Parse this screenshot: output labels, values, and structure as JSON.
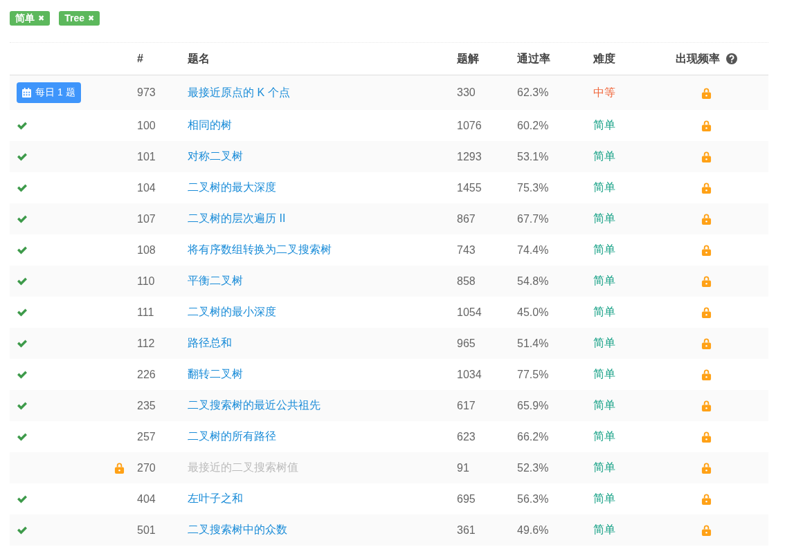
{
  "filters": [
    {
      "label": "简单",
      "remove_icon": "✖"
    },
    {
      "label": "Tree",
      "remove_icon": "✖"
    }
  ],
  "table": {
    "columns": [
      "#",
      "题名",
      "题解",
      "通过率",
      "难度",
      "出现频率"
    ],
    "rows": [
      {
        "kind": "daily",
        "badge": "每日 1 题",
        "number": "973",
        "title": "最接近原点的 K 个点",
        "solutions": "330",
        "acceptance": "62.3%",
        "difficulty": {
          "text": "中等",
          "kind": "medium"
        }
      },
      {
        "kind": "solved",
        "number": "100",
        "title": "相同的树",
        "solutions": "1076",
        "acceptance": "60.2%",
        "difficulty": {
          "text": "简单",
          "kind": "easy"
        }
      },
      {
        "kind": "solved",
        "number": "101",
        "title": "对称二叉树",
        "solutions": "1293",
        "acceptance": "53.1%",
        "difficulty": {
          "text": "简单",
          "kind": "easy"
        }
      },
      {
        "kind": "solved",
        "number": "104",
        "title": "二叉树的最大深度",
        "solutions": "1455",
        "acceptance": "75.3%",
        "difficulty": {
          "text": "简单",
          "kind": "easy"
        }
      },
      {
        "kind": "solved",
        "number": "107",
        "title": "二叉树的层次遍历 II",
        "solutions": "867",
        "acceptance": "67.7%",
        "difficulty": {
          "text": "简单",
          "kind": "easy"
        }
      },
      {
        "kind": "solved",
        "number": "108",
        "title": "将有序数组转换为二叉搜索树",
        "solutions": "743",
        "acceptance": "74.4%",
        "difficulty": {
          "text": "简单",
          "kind": "easy"
        }
      },
      {
        "kind": "solved",
        "number": "110",
        "title": "平衡二叉树",
        "solutions": "858",
        "acceptance": "54.8%",
        "difficulty": {
          "text": "简单",
          "kind": "easy"
        }
      },
      {
        "kind": "solved",
        "number": "111",
        "title": "二叉树的最小深度",
        "solutions": "1054",
        "acceptance": "45.0%",
        "difficulty": {
          "text": "简单",
          "kind": "easy"
        }
      },
      {
        "kind": "solved",
        "number": "112",
        "title": "路径总和",
        "solutions": "965",
        "acceptance": "51.4%",
        "difficulty": {
          "text": "简单",
          "kind": "easy"
        }
      },
      {
        "kind": "solved",
        "number": "226",
        "title": "翻转二叉树",
        "solutions": "1034",
        "acceptance": "77.5%",
        "difficulty": {
          "text": "简单",
          "kind": "easy"
        }
      },
      {
        "kind": "solved",
        "number": "235",
        "title": "二叉搜索树的最近公共祖先",
        "solutions": "617",
        "acceptance": "65.9%",
        "difficulty": {
          "text": "简单",
          "kind": "easy"
        }
      },
      {
        "kind": "solved",
        "number": "257",
        "title": "二叉树的所有路径",
        "solutions": "623",
        "acceptance": "66.2%",
        "difficulty": {
          "text": "简单",
          "kind": "easy"
        }
      },
      {
        "kind": "locked",
        "number": "270",
        "title": "最接近的二叉搜索树值",
        "solutions": "91",
        "acceptance": "52.3%",
        "difficulty": {
          "text": "简单",
          "kind": "easy"
        }
      },
      {
        "kind": "solved",
        "number": "404",
        "title": "左叶子之和",
        "solutions": "695",
        "acceptance": "56.3%",
        "difficulty": {
          "text": "简单",
          "kind": "easy"
        }
      },
      {
        "kind": "solved",
        "number": "501",
        "title": "二叉搜索树中的众数",
        "solutions": "361",
        "acceptance": "49.6%",
        "difficulty": {
          "text": "简单",
          "kind": "easy"
        }
      }
    ]
  }
}
